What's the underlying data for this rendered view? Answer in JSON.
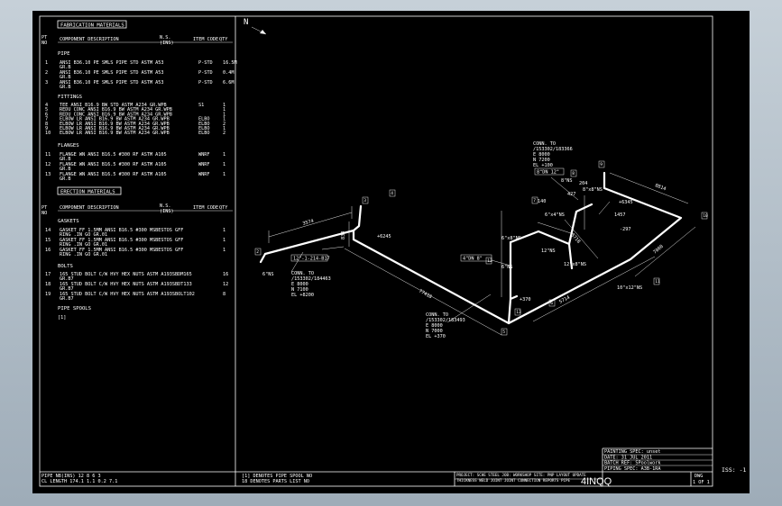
{
  "bom": {
    "fab_title": "FABRICATION MATERIALS",
    "pt_no": [
      "PT",
      "NO"
    ],
    "col_desc": "COMPONENT DESCRIPTION",
    "col_ns": [
      "N.S.",
      "(INS)"
    ],
    "col_code": "ITEM CODE",
    "col_qty": "QTY",
    "pipe_title": "PIPE",
    "pipe_rows": [
      {
        "no": "1",
        "desc": "ANSI B36.10 PE SMLS PIPE STD ASTM A53",
        "desc2": "GR.B",
        "code": "P-STD",
        "qty": "16.5M"
      },
      {
        "no": "2",
        "desc": "ANSI B36.10 PE SMLS PIPE STD ASTM A53",
        "desc2": "GR.B",
        "code": "P-STD",
        "qty": "0.4M"
      },
      {
        "no": "3",
        "desc": "ANSI B36.10 PE SMLS PIPE STD ASTM A53",
        "desc2": "GR.B",
        "code": "P-STD",
        "qty": "6.6M"
      }
    ],
    "fittings_title": "FITTINGS",
    "fitting_rows": [
      {
        "no": "4",
        "desc": "TEE ANSI B16.9 BW STD ASTM A234 GR.WPB",
        "code": "S1",
        "qty": "1"
      },
      {
        "no": "5",
        "desc": "REDU CONC ANSI B16.9 BW ASTM A234 GR.WPB",
        "code": "",
        "qty": "1"
      },
      {
        "no": "6",
        "desc": "REDU CONC ANSI B16.9 BW ASTM A234 GR.WPB",
        "code": "",
        "qty": "1"
      },
      {
        "no": "7",
        "desc": "ELBOW LR ANSI B16.9 BW ASTM A234 GR.WPB",
        "code": "ELBO",
        "qty": "1"
      },
      {
        "no": "8",
        "desc": "ELBOW LR ANSI B16.9 BW ASTM A234 GR.WPB",
        "code": "ELBO",
        "qty": "2"
      },
      {
        "no": "9",
        "desc": "ELBOW LR ANSI B16.9 BW ASTM A234 GR.WPB",
        "code": "ELBO",
        "qty": "1"
      },
      {
        "no": "10",
        "desc": "ELBOW LR ANSI B16.9 BW ASTM A234 GR.WPB",
        "code": "ELBO",
        "qty": "2"
      }
    ],
    "flanges_title": "FLANGES",
    "flange_rows": [
      {
        "no": "11",
        "desc": "FLANGE WN ANSI B16.5 #300 RF ASTM A105",
        "desc2": "GR.B",
        "code": "WNRF",
        "qty": "1"
      },
      {
        "no": "12",
        "desc": "FLANGE WN ANSI B16.5 #300 RF ASTM A105",
        "desc2": "GR.B",
        "code": "WNRF",
        "qty": "1"
      },
      {
        "no": "13",
        "desc": "FLANGE WN ANSI B16.5 #300 RF ASTM A105",
        "desc2": "GR.B",
        "code": "WNRF",
        "qty": "1"
      }
    ],
    "erection_title": "ERECTION MATERIALS",
    "gaskets_title": "GASKETS",
    "gasket_rows": [
      {
        "no": "14",
        "desc": "GASKET FF 1.5MM ANSI B16.5 #300 MSBESTOS GFF",
        "desc2": "RING .IN GO GR.01",
        "qty": "1"
      },
      {
        "no": "15",
        "desc": "GASKET FF 1.5MM ANSI B16.5 #300 MSBESTOS GFF",
        "desc2": "RING .IN GO GR.01",
        "qty": "1"
      },
      {
        "no": "16",
        "desc": "GASKET FF 1.5MM ANSI B16.5 #300 MSBESTOS GFF",
        "desc2": "RING .IN GO GR.01",
        "qty": "1"
      }
    ],
    "bolts_title": "BOLTS",
    "bolt_rows": [
      {
        "no": "17",
        "desc": "165 STUD BOLT C/W HVY HEX NUTS ASTM A193SBDM165",
        "desc2": "GR.B7",
        "qty": "16"
      },
      {
        "no": "18",
        "desc": "165 STUD BOLT C/W HVY HEX NUTS ASTM A193SBDT133",
        "desc2": "GR.B7",
        "qty": "12"
      },
      {
        "no": "19",
        "desc": "165 STUD BOLT C/W HVY HEX NUTS ASTM A193SBOLT102",
        "desc2": "GR.B7",
        "qty": "8"
      }
    ],
    "spools_title": "PIPE SPOOLS",
    "spools_item": "[1]"
  },
  "footer": {
    "pipe_nbins": "PIPE NB(INS)    12    8    6    3",
    "cl_length": "CL LENGTH  174.1  1.1  0.2  7.1",
    "note1": "[1] DENOTES PIPE SPOOL NO",
    "note2": "18 DENOTES PARTS LIST NO",
    "painting_spec": "PAINTING SPEC: unset",
    "date": "DATE: 31 JUL 2011",
    "batch": "BATCH REF: SPoolwork",
    "piping_spec": "PIPING SPEC: A3B-1RA",
    "drawing_no": "4INQQ",
    "dwg_label": "DWG",
    "sheet_of": "1 OF 1",
    "iss": "ISS: -1",
    "hdr1": "PROJECT: SCHE STEEL JOB: WORKSHOP  SITE: PNP  LAYOUT UPDATE",
    "hdr2": "THICKNESS  WELD  JOINT  JOINT CONNECTION REPORTS  PIPE"
  },
  "iso": {
    "north": "N",
    "conn1": [
      "CONN. TO",
      "/153302/183366",
      "E 8000",
      "N 7200",
      "EL +100"
    ],
    "conn2": [
      "CONN. TO",
      "/153302/184463",
      "E 8000",
      "N 7100",
      "EL +8200"
    ],
    "conn3": [
      "CONN. TO",
      "/153302/183493",
      "E 8000",
      "N 7000",
      "EL +370"
    ],
    "box1": "8\"DN 12\"",
    "box2": "12\"-1-214-B17",
    "box3": "4\"DN 8\"",
    "dims": [
      "3574",
      "834",
      "+6245",
      "77418",
      "5714",
      "140",
      "3718",
      "7000",
      "8814",
      "204",
      "427",
      "1457",
      "+370",
      "-297",
      "+6345"
    ],
    "tags": [
      "6\"NS",
      "8\"NS",
      "6\"NS",
      "12\"NS",
      "6\"x4\"NS",
      "10\"x12\"NS",
      "12\"x8\"NS",
      "8\"x8\"NS",
      "6\"x8\"NS"
    ],
    "points": [
      "2",
      "3",
      "4",
      "5",
      "6",
      "7",
      "8",
      "9",
      "10",
      "11",
      "12",
      "13"
    ]
  }
}
